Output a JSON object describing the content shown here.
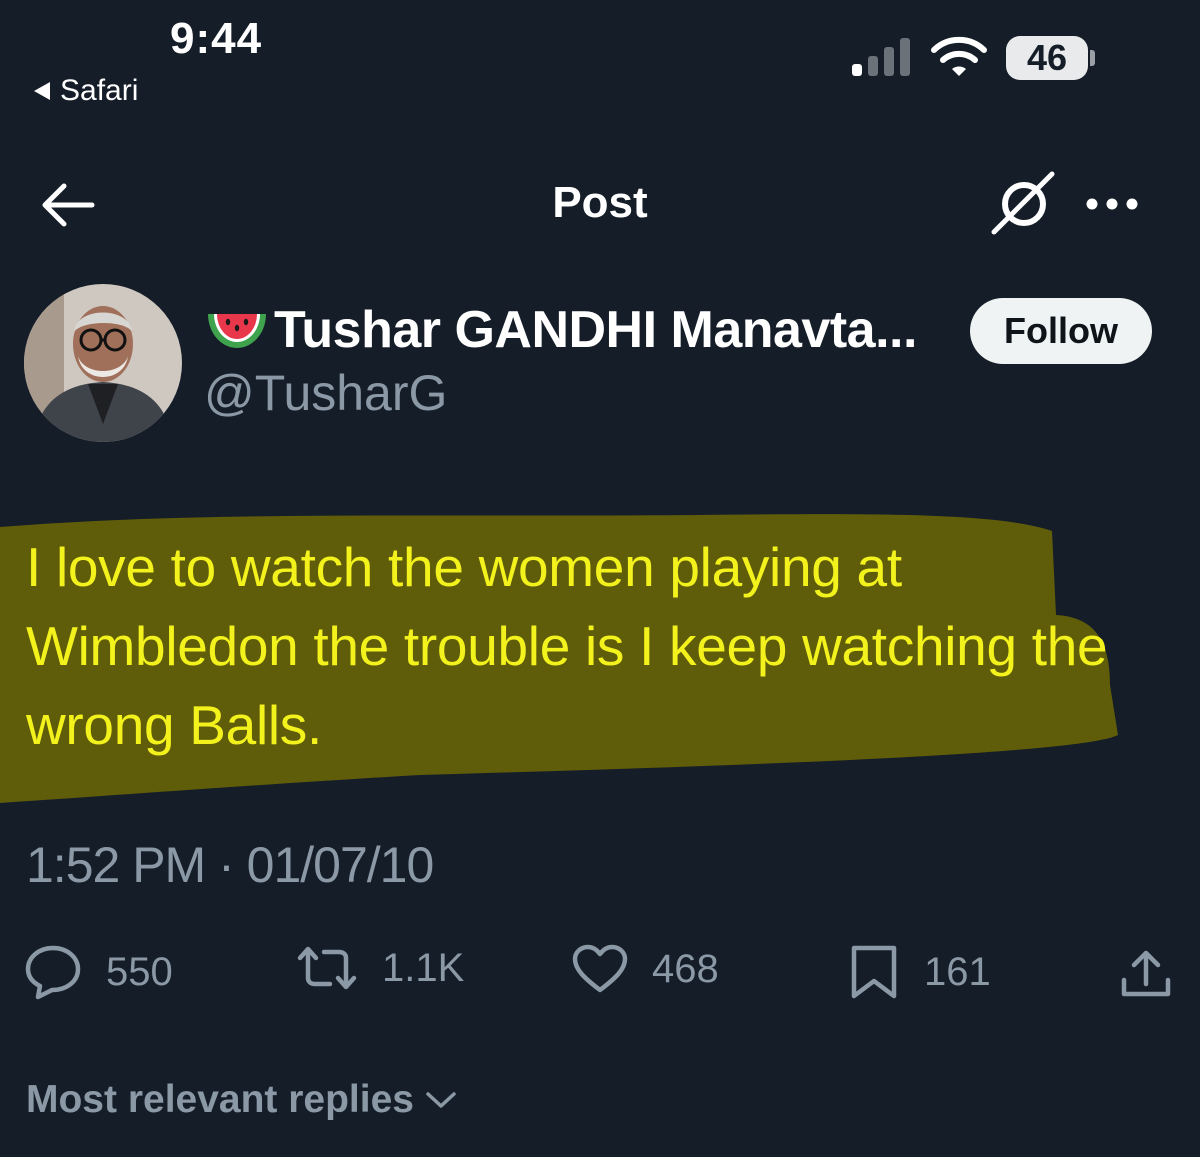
{
  "status_bar": {
    "time": "9:44",
    "back_app": "Safari",
    "battery": "46",
    "icons": [
      "signal-icon",
      "wifi-icon",
      "battery-icon"
    ]
  },
  "header": {
    "title": "Post",
    "icons": [
      "back-arrow-icon",
      "grok-icon",
      "more-icon"
    ]
  },
  "author": {
    "display_name": "Tushar GANDHI Manavta...",
    "handle": "@TusharG",
    "emoji_icon": "watermelon-icon",
    "follow_label": "Follow"
  },
  "tweet": {
    "text": "I love to watch the women playing at Wimbledon the trouble is I keep watching the wrong Balls.",
    "timestamp": "1:52 PM · 01/07/10",
    "highlight_color": "#5f5c0a",
    "text_color": "#f3f21c"
  },
  "actions": {
    "replies": "550",
    "reposts": "1.1K",
    "likes": "468",
    "bookmarks": "161",
    "icons": [
      "reply-icon",
      "repost-icon",
      "like-icon",
      "bookmark-icon",
      "share-icon"
    ]
  },
  "replies_filter": {
    "label": "Most relevant replies"
  }
}
